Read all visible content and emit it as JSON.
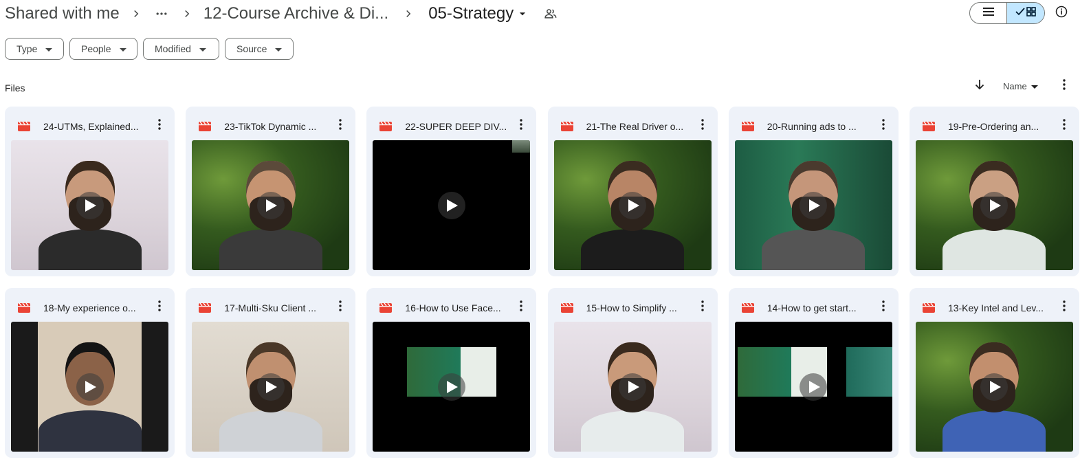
{
  "breadcrumb": {
    "root": "Shared with me",
    "middle": "12-Course Archive & Di...",
    "current": "05-Strategy"
  },
  "filters": [
    "Type",
    "People",
    "Modified",
    "Source"
  ],
  "files_label": "Files",
  "sort": {
    "label": "Name"
  },
  "accent_color": "#c2e7ff",
  "file_icon_color": "#ea4335",
  "icons": {
    "breadcrumb_sep": "chevron-right-icon",
    "overflow": "more-horiz-icon",
    "shared_folder": "people-icon",
    "list_view": "list-view-icon",
    "grid_view": "grid-view-icon",
    "info": "info-icon",
    "file_type": "video-file-icon",
    "play": "play-icon"
  },
  "files": [
    {
      "title": "24-UTMs, Explained..."
    },
    {
      "title": "23-TikTok Dynamic ..."
    },
    {
      "title": "22-SUPER DEEP DIV..."
    },
    {
      "title": "21-The Real Driver o..."
    },
    {
      "title": "20-Running ads to ..."
    },
    {
      "title": "19-Pre-Ordering an..."
    },
    {
      "title": "18-My experience o..."
    },
    {
      "title": "17-Multi-Sku Client ..."
    },
    {
      "title": "16-How to Use Face..."
    },
    {
      "title": "15-How to Simplify ..."
    },
    {
      "title": "14-How to get start..."
    },
    {
      "title": "13-Key Intel and Lev..."
    }
  ]
}
